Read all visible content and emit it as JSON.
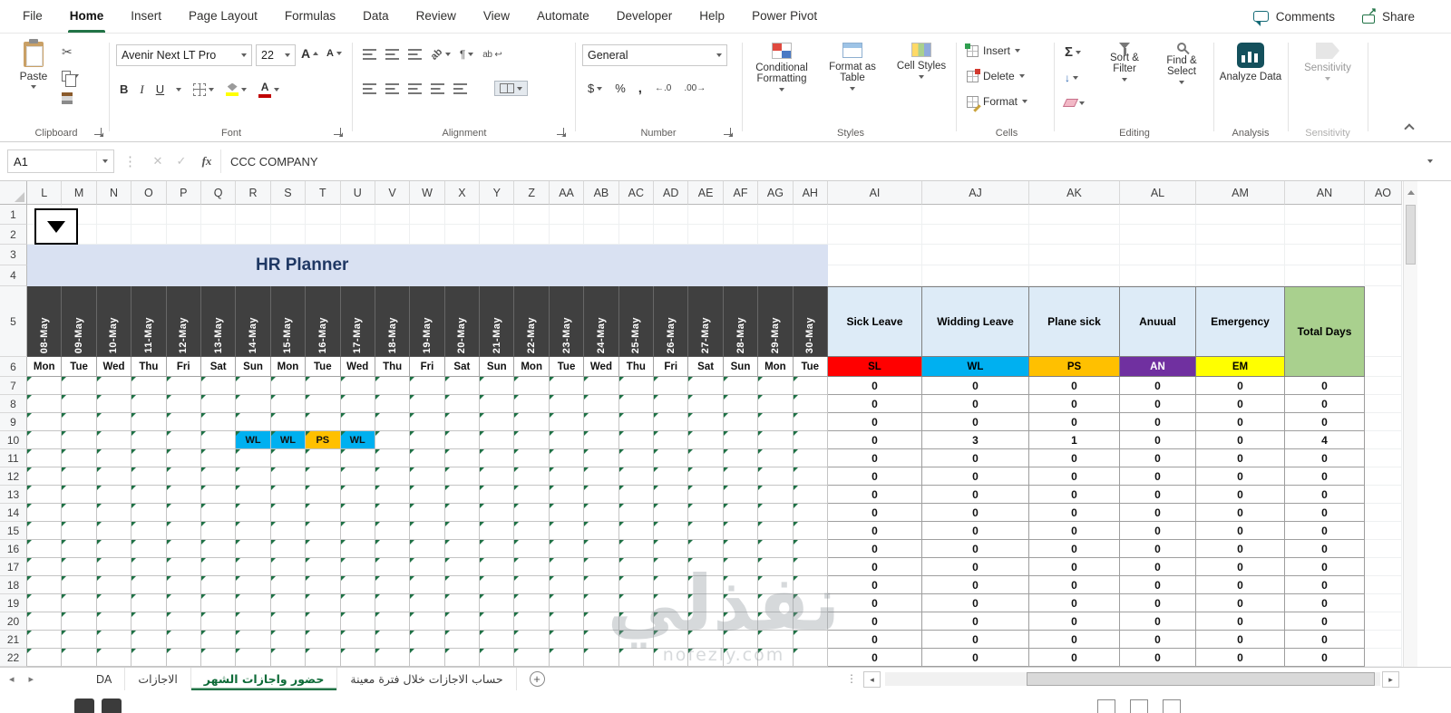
{
  "app": {
    "tabs": [
      {
        "label": "File"
      },
      {
        "label": "Home",
        "active": true
      },
      {
        "label": "Insert"
      },
      {
        "label": "Page Layout"
      },
      {
        "label": "Formulas"
      },
      {
        "label": "Data"
      },
      {
        "label": "Review"
      },
      {
        "label": "View"
      },
      {
        "label": "Automate"
      },
      {
        "label": "Developer"
      },
      {
        "label": "Help"
      },
      {
        "label": "Power Pivot"
      }
    ],
    "comments_label": "Comments",
    "share_label": "Share"
  },
  "ribbon": {
    "clipboard": {
      "group_label": "Clipboard",
      "paste_label": "Paste"
    },
    "font": {
      "group_label": "Font",
      "font_name": "Avenir Next LT Pro",
      "font_size": "22",
      "bold": "B",
      "italic": "I",
      "underline": "U",
      "font_grow": "A",
      "font_shrink": "A"
    },
    "alignment": {
      "group_label": "Alignment",
      "wrap_icon_text": "ab",
      "orientation_icon_text": "ab",
      "paragraph": "¶"
    },
    "number": {
      "group_label": "Number",
      "format_selected": "General",
      "currency": "$",
      "percent": "%",
      "comma": ",",
      "increase_decimal": "←.0",
      "decrease_decimal": ".00→"
    },
    "styles": {
      "group_label": "Styles",
      "conditional_formatting": "Conditional Formatting",
      "format_as_table": "Format as Table",
      "cell_styles": "Cell Styles"
    },
    "cells": {
      "group_label": "Cells",
      "insert": "Insert",
      "delete": "Delete",
      "format": "Format"
    },
    "editing": {
      "group_label": "Editing",
      "autosum": "Σ",
      "fill": "↓",
      "sort_filter": "Sort & Filter",
      "find_select": "Find & Select"
    },
    "analysis": {
      "group_label": "Analysis",
      "analyze_data": "Analyze Data"
    },
    "sensitivity": {
      "group_label": "Sensitivity",
      "sensitivity": "Sensitivity"
    }
  },
  "formula_bar": {
    "name_box": "A1",
    "fx": "fx",
    "value": "CCC COMPANY"
  },
  "sheet": {
    "title": "HR Planner",
    "column_headers": [
      "L",
      "M",
      "N",
      "O",
      "P",
      "Q",
      "R",
      "S",
      "T",
      "U",
      "V",
      "W",
      "X",
      "Y",
      "Z",
      "AA",
      "AB",
      "AC",
      "AD",
      "AE",
      "AF",
      "AG",
      "AH",
      "AI",
      "AJ",
      "AK",
      "AL",
      "AM",
      "AN",
      "AO"
    ],
    "row_numbers": [
      1,
      2,
      3,
      4,
      5,
      6,
      7,
      8,
      9,
      10,
      11,
      12,
      13,
      14,
      15,
      16,
      17,
      18,
      19,
      20,
      21,
      22
    ],
    "dates": [
      "08-May",
      "09-May",
      "10-May",
      "11-May",
      "12-May",
      "13-May",
      "14-May",
      "15-May",
      "16-May",
      "17-May",
      "18-May",
      "19-May",
      "20-May",
      "21-May",
      "22-May",
      "23-May",
      "24-May",
      "25-May",
      "26-May",
      "27-May",
      "28-May",
      "29-May",
      "30-May"
    ],
    "days": [
      "Mon",
      "Tue",
      "Wed",
      "Thu",
      "Fri",
      "Sat",
      "Sun",
      "Mon",
      "Tue",
      "Wed",
      "Thu",
      "Fri",
      "Sat",
      "Sun",
      "Mon",
      "Tue",
      "Wed",
      "Thu",
      "Fri",
      "Sat",
      "Sun",
      "Mon",
      "Tue"
    ],
    "leave_types": [
      {
        "name": "Sick Leave",
        "code": "SL",
        "color": "#FF0000",
        "code_text_color": "#000000"
      },
      {
        "name": "Widding Leave",
        "code": "WL",
        "color": "#00B0F0",
        "code_text_color": "#000000"
      },
      {
        "name": "Plane sick",
        "code": "PS",
        "color": "#FFC000",
        "code_text_color": "#000000"
      },
      {
        "name": "Anuual",
        "code": "AN",
        "color": "#7030A0",
        "code_text_color": "#FFFFFF"
      },
      {
        "name": "Emergency",
        "code": "EM",
        "color": "#FFFF00",
        "code_text_color": "#000000"
      }
    ],
    "total_column": {
      "name": "Total Days",
      "color": "#A9D08E"
    },
    "marks": [
      {
        "row": 10,
        "col_index": 6,
        "date": "14-May",
        "code": "WL"
      },
      {
        "row": 10,
        "col_index": 7,
        "date": "15-May",
        "code": "WL"
      },
      {
        "row": 10,
        "col_index": 8,
        "date": "16-May",
        "code": "PS"
      },
      {
        "row": 10,
        "col_index": 9,
        "date": "17-May",
        "code": "WL"
      }
    ],
    "data_rows": [
      {
        "row": 7,
        "values": [
          "0",
          "0",
          "0",
          "0",
          "0",
          "0"
        ]
      },
      {
        "row": 8,
        "values": [
          "0",
          "0",
          "0",
          "0",
          "0",
          "0"
        ]
      },
      {
        "row": 9,
        "values": [
          "0",
          "0",
          "0",
          "0",
          "0",
          "0"
        ]
      },
      {
        "row": 10,
        "values": [
          "0",
          "3",
          "1",
          "0",
          "0",
          "4"
        ]
      },
      {
        "row": 11,
        "values": [
          "0",
          "0",
          "0",
          "0",
          "0",
          "0"
        ]
      },
      {
        "row": 12,
        "values": [
          "0",
          "0",
          "0",
          "0",
          "0",
          "0"
        ]
      },
      {
        "row": 13,
        "values": [
          "0",
          "0",
          "0",
          "0",
          "0",
          "0"
        ]
      },
      {
        "row": 14,
        "values": [
          "0",
          "0",
          "0",
          "0",
          "0",
          "0"
        ]
      },
      {
        "row": 15,
        "values": [
          "0",
          "0",
          "0",
          "0",
          "0",
          "0"
        ]
      },
      {
        "row": 16,
        "values": [
          "0",
          "0",
          "0",
          "0",
          "0",
          "0"
        ]
      },
      {
        "row": 17,
        "values": [
          "0",
          "0",
          "0",
          "0",
          "0",
          "0"
        ]
      },
      {
        "row": 18,
        "values": [
          "0",
          "0",
          "0",
          "0",
          "0",
          "0"
        ]
      },
      {
        "row": 19,
        "values": [
          "0",
          "0",
          "0",
          "0",
          "0",
          "0"
        ]
      },
      {
        "row": 20,
        "values": [
          "0",
          "0",
          "0",
          "0",
          "0",
          "0"
        ]
      },
      {
        "row": 21,
        "values": [
          "0",
          "0",
          "0",
          "0",
          "0",
          "0"
        ]
      },
      {
        "row": 22,
        "values": [
          "0",
          "0",
          "0",
          "0",
          "0",
          "0"
        ]
      }
    ]
  },
  "sheet_tabs": {
    "tabs": [
      {
        "label": "DA"
      },
      {
        "label": "الاجازات",
        "rtl": true
      },
      {
        "label": "حضور واجازات الشهر",
        "rtl": true,
        "active": true
      },
      {
        "label": "حساب الاجازات خلال فترة معينة",
        "rtl": true
      }
    ],
    "add_label": "+"
  },
  "watermark": {
    "text": "نفذلي",
    "subtext": "nofezly.com"
  }
}
